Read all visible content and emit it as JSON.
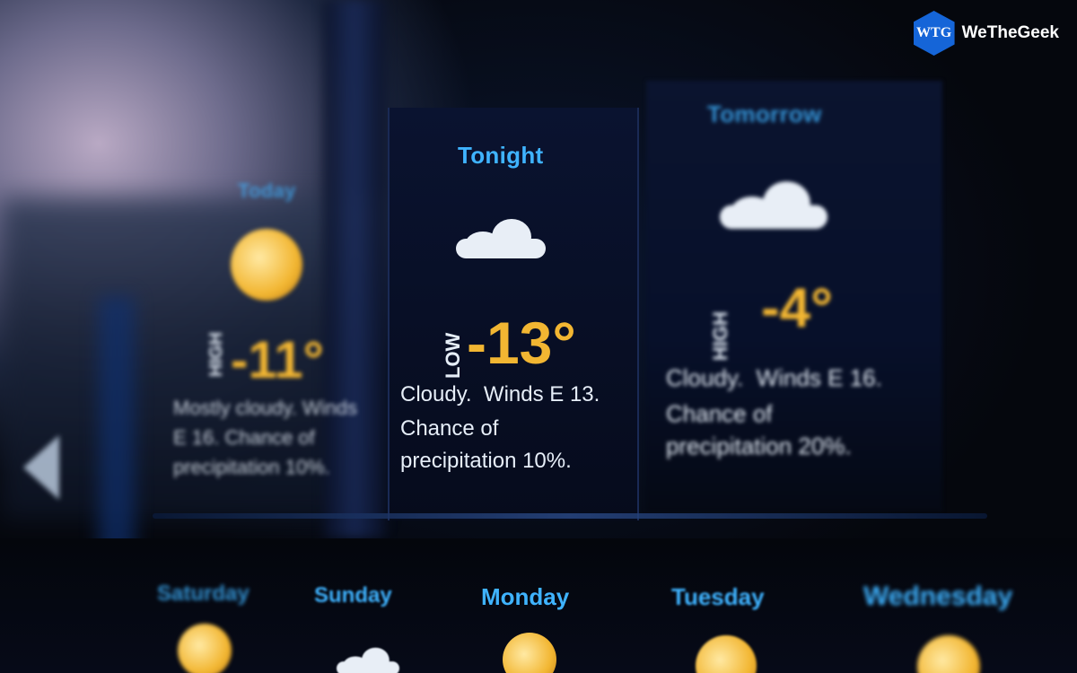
{
  "brand": {
    "badge": "WTG",
    "name": "WeTheGeek"
  },
  "panels": {
    "today": {
      "title": "Today",
      "label": "HIGH",
      "temp": "-11°",
      "desc": "Mostly cloudy. Winds E 16. Chance of precipitation 10%."
    },
    "tonight": {
      "title": "Tonight",
      "label": "LOW",
      "temp": "-13°",
      "desc_line1": "Cloudy.  Winds E 13.",
      "desc_line2": "Chance of",
      "desc_line3": "precipitation 10%."
    },
    "tomorrow": {
      "title": "Tomorrow",
      "label": "HIGH",
      "temp": "-4°",
      "desc_line1": "Cloudy.  Winds E 16.",
      "desc_line2": "Chance of",
      "desc_line3": "precipitation 20%."
    }
  },
  "week": {
    "saturday": "Saturday",
    "sunday": "Sunday",
    "monday": "Monday",
    "tuesday": "Tuesday",
    "wednesday": "Wednesday"
  },
  "colors": {
    "accent": "#3fb3ff",
    "temp": "#f2b632",
    "brand": "#1565d8"
  }
}
